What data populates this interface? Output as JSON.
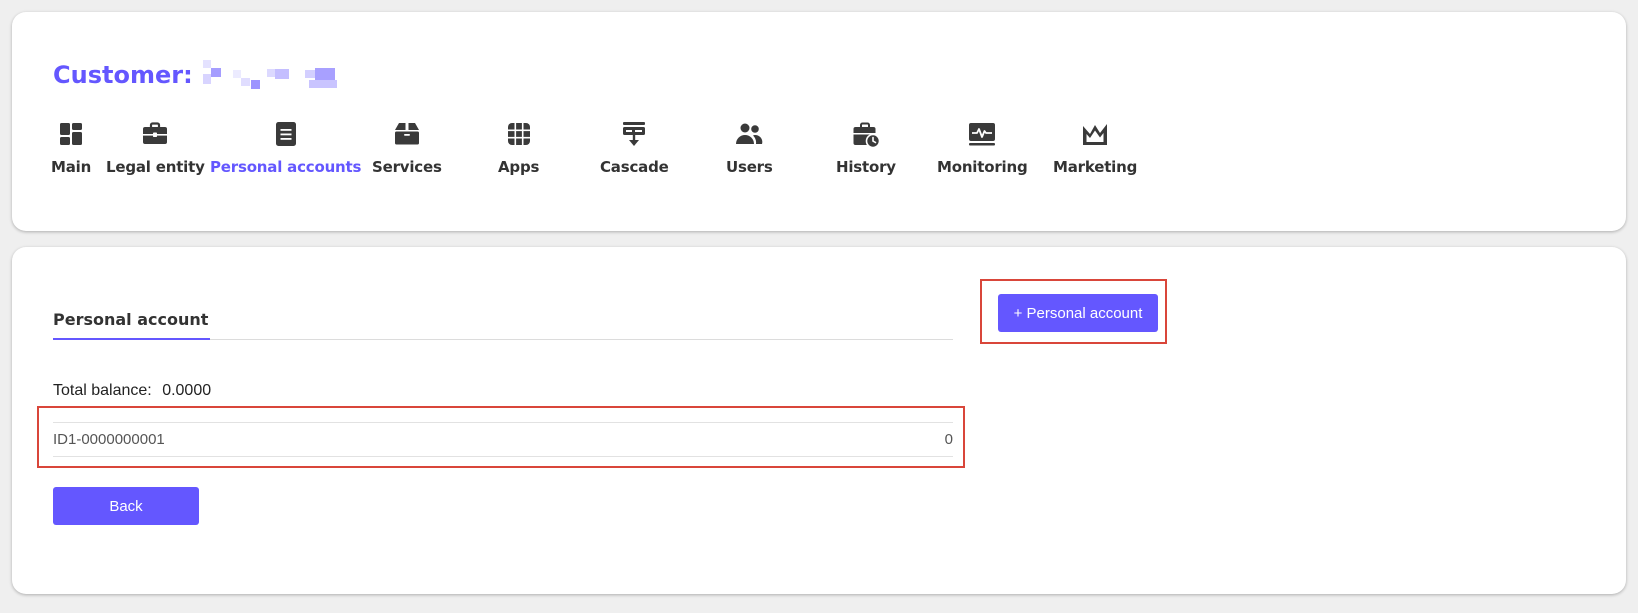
{
  "header": {
    "title": "Customer:",
    "customer_name_redacted": true
  },
  "nav": {
    "active": "Personal accounts",
    "items": [
      {
        "label": "Main",
        "icon": "dashboard-icon"
      },
      {
        "label": "Legal entity",
        "icon": "briefcase-icon"
      },
      {
        "label": "Personal accounts",
        "icon": "document-icon"
      },
      {
        "label": "Services",
        "icon": "box-icon"
      },
      {
        "label": "Apps",
        "icon": "apps-grid-icon"
      },
      {
        "label": "Cascade",
        "icon": "cascade-icon"
      },
      {
        "label": "Users",
        "icon": "users-icon"
      },
      {
        "label": "History",
        "icon": "history-icon"
      },
      {
        "label": "Monitoring",
        "icon": "monitoring-icon"
      },
      {
        "label": "Marketing",
        "icon": "marketing-icon"
      }
    ]
  },
  "accounts": {
    "tab_label": "Personal account",
    "add_button_label": "+ Personal account",
    "total_balance_label": "Total balance:",
    "total_balance_value": "0.0000",
    "list": [
      {
        "id": "ID1-0000000001",
        "balance": "0"
      }
    ],
    "back_label": "Back"
  },
  "colors": {
    "accent": "#6457ff",
    "highlight_frame": "#d9463a",
    "text": "#333333",
    "background": "#efefef"
  }
}
